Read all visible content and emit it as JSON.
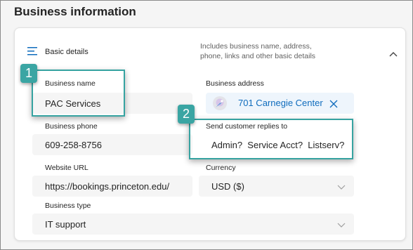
{
  "page": {
    "title": "Business information"
  },
  "section": {
    "icon": "list-icon",
    "title": "Basic details",
    "description": "Includes business name, address, phone, links and other basic details",
    "collapse_icon": "chevron-up-icon"
  },
  "fields": {
    "business_name": {
      "label": "Business name",
      "value": "PAC Services"
    },
    "business_address": {
      "label": "Business address",
      "value": "701 Carnegie Center",
      "avatar_icon": "map-pin-avatar-icon",
      "remove_icon": "close-icon"
    },
    "business_phone": {
      "label": "Business phone",
      "value": "609-258-8756"
    },
    "send_replies": {
      "label": "Send customer replies to",
      "value": "Admin?  Service Acct?  Listserv?"
    },
    "website_url": {
      "label": "Website URL",
      "value": "https://bookings.princeton.edu/"
    },
    "currency": {
      "label": "Currency",
      "value": "USD ($)",
      "dropdown_icon": "chevron-down-icon"
    },
    "business_type": {
      "label": "Business type",
      "value": "IT support",
      "dropdown_icon": "chevron-down-icon"
    }
  },
  "callouts": [
    {
      "number": "1",
      "target": "Business name"
    },
    {
      "number": "2",
      "target": "Send customer replies to"
    }
  ],
  "colors": {
    "accent": "#0f6cbd",
    "callout": "#36a3a1",
    "field_bg": "#f5f5f5"
  }
}
